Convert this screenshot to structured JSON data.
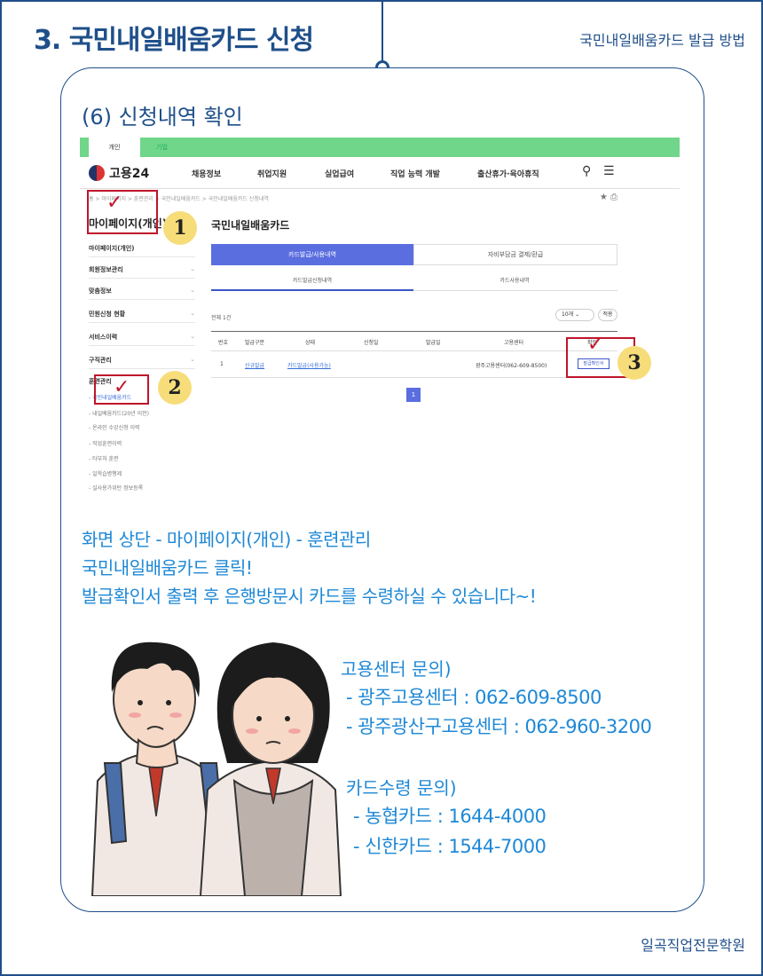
{
  "header": {
    "title": "3. 국민내일배움카드 신청",
    "subtitle": "국민내일배움카드 발급 방법"
  },
  "section": {
    "title": "(6) 신청내역 확인"
  },
  "screenshot": {
    "tabs": [
      "개인",
      "기업"
    ],
    "logo": "고용24",
    "nav": [
      "채용정보",
      "취업지원",
      "실업급여",
      "직업 능력 개발",
      "출산휴가·육아휴직"
    ],
    "breadcrumb": "홈 > 마이페이지 > 훈련관리 > 국민내일배움카드 > 국민내일배움카드 신청내역",
    "sidebar": {
      "title": "마이페이지(개인)",
      "items": [
        "마이페이지(개인)",
        "회원정보관리",
        "맞춤정보",
        "민원신청 현황",
        "서비스이력",
        "구직관리",
        "훈련관리"
      ],
      "subitems": [
        "- 국민내일배움카드",
        "- 내일배움카드(20년 이전)",
        "- 온라인 수강신청 이력",
        "- 직업훈련이력",
        "- 타부처 훈련",
        "- 일학습병행제",
        "- 실사용가위탄 정보등록"
      ]
    },
    "main_title": "국민내일배움카드",
    "buttons": {
      "primary": "카드발급/사용내역",
      "secondary": "자비부담금 결제/환급"
    },
    "subtabs": [
      "카드발급신청내역",
      "카드사용내역"
    ],
    "total": "전체 1건",
    "per_page": "10개",
    "apply": "적용",
    "table": {
      "headers": [
        "번호",
        "발급구분",
        "상태",
        "신청일",
        "발급일",
        "고용센터",
        "확인"
      ],
      "row": [
        "1",
        "신규발급",
        "카드발급(사용가능)",
        "광주고용센터(062-609-8500)",
        "발급확인서"
      ]
    },
    "pager": "1"
  },
  "markers": [
    "1",
    "2",
    "3"
  ],
  "instructions": [
    "화면 상단 - 마이페이지(개인) - 훈련관리",
    "국민내일배움카드 클릭!",
    "발급확인서 출력 후 은행방문시 카드를 수령하실 수 있습니다~!"
  ],
  "contacts": {
    "employment_head": "고용센터 문의)",
    "employment": [
      "- 광주고용센터 : 062-609-8500",
      "- 광주광산구고용센터 : 062-960-3200"
    ],
    "card_head": "카드수령 문의)",
    "card": [
      "- 농협카드 : 1644-4000",
      "- 신한카드 : 1544-7000"
    ]
  },
  "footer": "일곡직업전문학원",
  "colors": {
    "brand": "#1f4f8a",
    "accent": "#1e88d6",
    "marker": "#c0142a",
    "badge": "#f7dd7a"
  }
}
